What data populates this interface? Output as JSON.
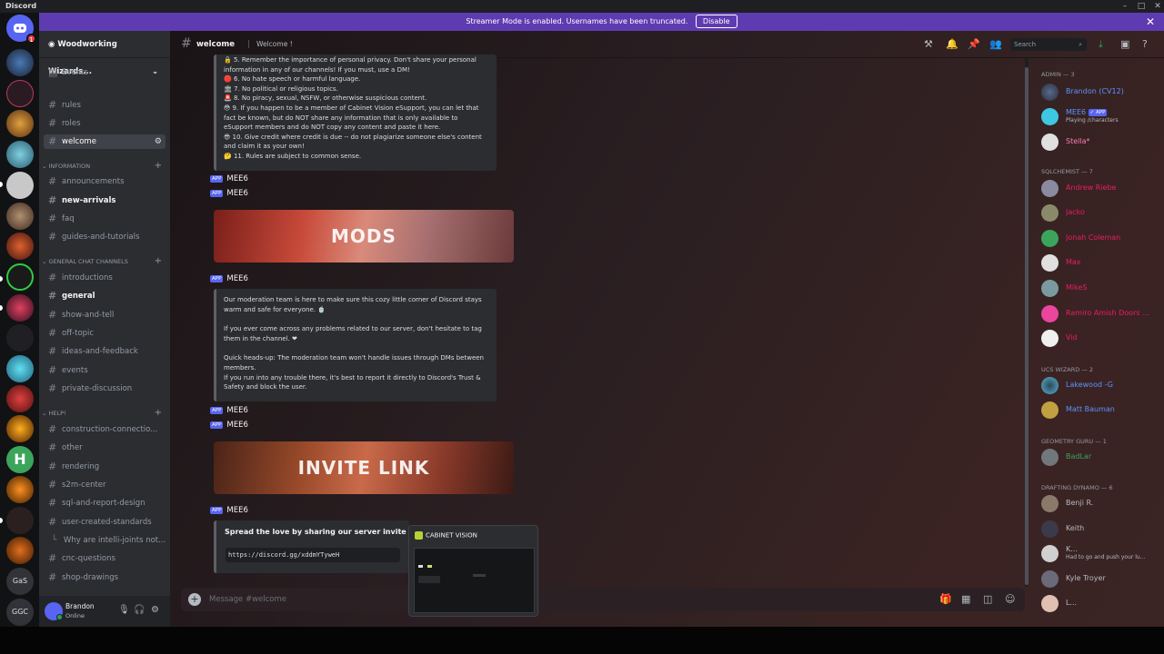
{
  "titlebar": {
    "app": "Discord"
  },
  "banner": {
    "text": "Streamer Mode is enabled. Usernames have been truncated.",
    "button": "Disable"
  },
  "servers": {
    "text_items": [
      "GaS",
      "GGC"
    ],
    "badge": "1"
  },
  "guild": {
    "name": "Woodworking Wizards..."
  },
  "sidebar": {
    "events": "Events",
    "top_channels": [
      "rules",
      "roles",
      "welcome"
    ],
    "categories": [
      {
        "name": "INFORMATION",
        "channels": [
          "announcements",
          "new-arrivals",
          "faq",
          "guides-and-tutorials"
        ]
      },
      {
        "name": "GENERAL CHAT CHANNELS",
        "channels": [
          "introductions",
          "general",
          "show-and-tell",
          "off-topic",
          "ideas-and-feedback",
          "events",
          "private-discussion"
        ]
      },
      {
        "name": "HELP!",
        "channels": [
          "construction-connectio...",
          "other",
          "rendering",
          "s2m-center",
          "sql-and-report-design",
          "user-created-standards"
        ]
      }
    ],
    "thread": "Why are intelli-joints not...",
    "extra_channels": [
      "cnc-questions",
      "shop-drawings"
    ]
  },
  "user": {
    "name": "Brandon",
    "status": "Online"
  },
  "channel": {
    "name": "welcome",
    "topic": "Welcome !"
  },
  "search": {
    "placeholder": "Search"
  },
  "rules_embed": {
    "lines": [
      "5. Remember the importance of personal privacy. Don't share your personal",
      "information in any of our channels! If you must, use a DM!",
      "6. No hate speech or harmful language.",
      "7. No political or religious topics.",
      "8. No piracy, sexual, NSFW, or otherwise suspicious content.",
      "9. If you happen to be a member of Cabinet Vision eSupport, you can let that",
      "fact be known, but do NOT share any information that is only available to",
      "eSupport members and do NOT copy any content and paste it here.",
      "10. Give credit where credit is due -- do not plagiarize someone else's content",
      "and claim it as your own!",
      "11. Rules are subject to common sense."
    ],
    "emojis": [
      "🔒",
      "🛑",
      "🏛",
      "🚨",
      "😳",
      "😎",
      "🤔"
    ]
  },
  "bot": {
    "tag": "APP",
    "name": "MEE6"
  },
  "banners": {
    "mods": "MODS",
    "invite": "INVITE LINK"
  },
  "mod_embed": {
    "lines": [
      "Our moderation team is here to make sure this cozy little corner of Discord stays",
      "warm and safe for everyone. 🍵",
      "",
      "If you ever come across any problems related to our server, don't hesitate to tag",
      "them in the channel. ❤",
      "",
      "Quick heads-up: The moderation team won't handle issues through DMs between",
      "members.",
      "If you run into any trouble there, it's best to report it directly to Discord's Trust &",
      "Safety and block the user."
    ]
  },
  "invite_embed": {
    "title": "Spread the love by sharing our server invite link",
    "link": "https://discord.gg/xddmYTyweH"
  },
  "popup": {
    "title": "CABINET VISION"
  },
  "composer": {
    "placeholder": "Message #welcome"
  },
  "members": {
    "groups": [
      {
        "name": "ADMIN — 3",
        "members": [
          {
            "name": "Brandon (CV12)",
            "color": "#5e93ff"
          },
          {
            "name": "MEE6",
            "color": "#5e93ff",
            "tag": "✓ APP",
            "sub": "Playing /characters"
          },
          {
            "name": "Stella*",
            "color": "#ff7ab6"
          }
        ]
      },
      {
        "name": "SQLCHEMIST — 7",
        "members": [
          {
            "name": "Andrew Riebe",
            "color": "#e91e63"
          },
          {
            "name": "Jacko",
            "color": "#e91e63"
          },
          {
            "name": "Jonah Coleman",
            "color": "#e91e63"
          },
          {
            "name": "Max",
            "color": "#e91e63"
          },
          {
            "name": "MikeS",
            "color": "#e91e63"
          },
          {
            "name": "Ramiro Amish Doors ...",
            "color": "#e91e63"
          },
          {
            "name": "Vid",
            "color": "#e91e63"
          }
        ]
      },
      {
        "name": "UCS WIZARD — 2",
        "members": [
          {
            "name": "Lakewood -G",
            "color": "#5e93ff"
          },
          {
            "name": "Matt Bauman",
            "color": "#5e93ff"
          }
        ]
      },
      {
        "name": "GEOMETRY GURU — 1",
        "members": [
          {
            "name": "BadLar",
            "color": "#3ba55c"
          }
        ]
      },
      {
        "name": "DRAFTING DYNAMO — 6",
        "members": [
          {
            "name": "Benji R.",
            "color": "#b5bac1"
          },
          {
            "name": "Keith",
            "color": "#b5bac1"
          },
          {
            "name": "K...",
            "color": "#b5bac1",
            "sub": "Had to go and push your lu..."
          },
          {
            "name": "Kyle Troyer",
            "color": "#b5bac1"
          },
          {
            "name": "L...",
            "color": "#b5bac1"
          }
        ]
      }
    ]
  }
}
